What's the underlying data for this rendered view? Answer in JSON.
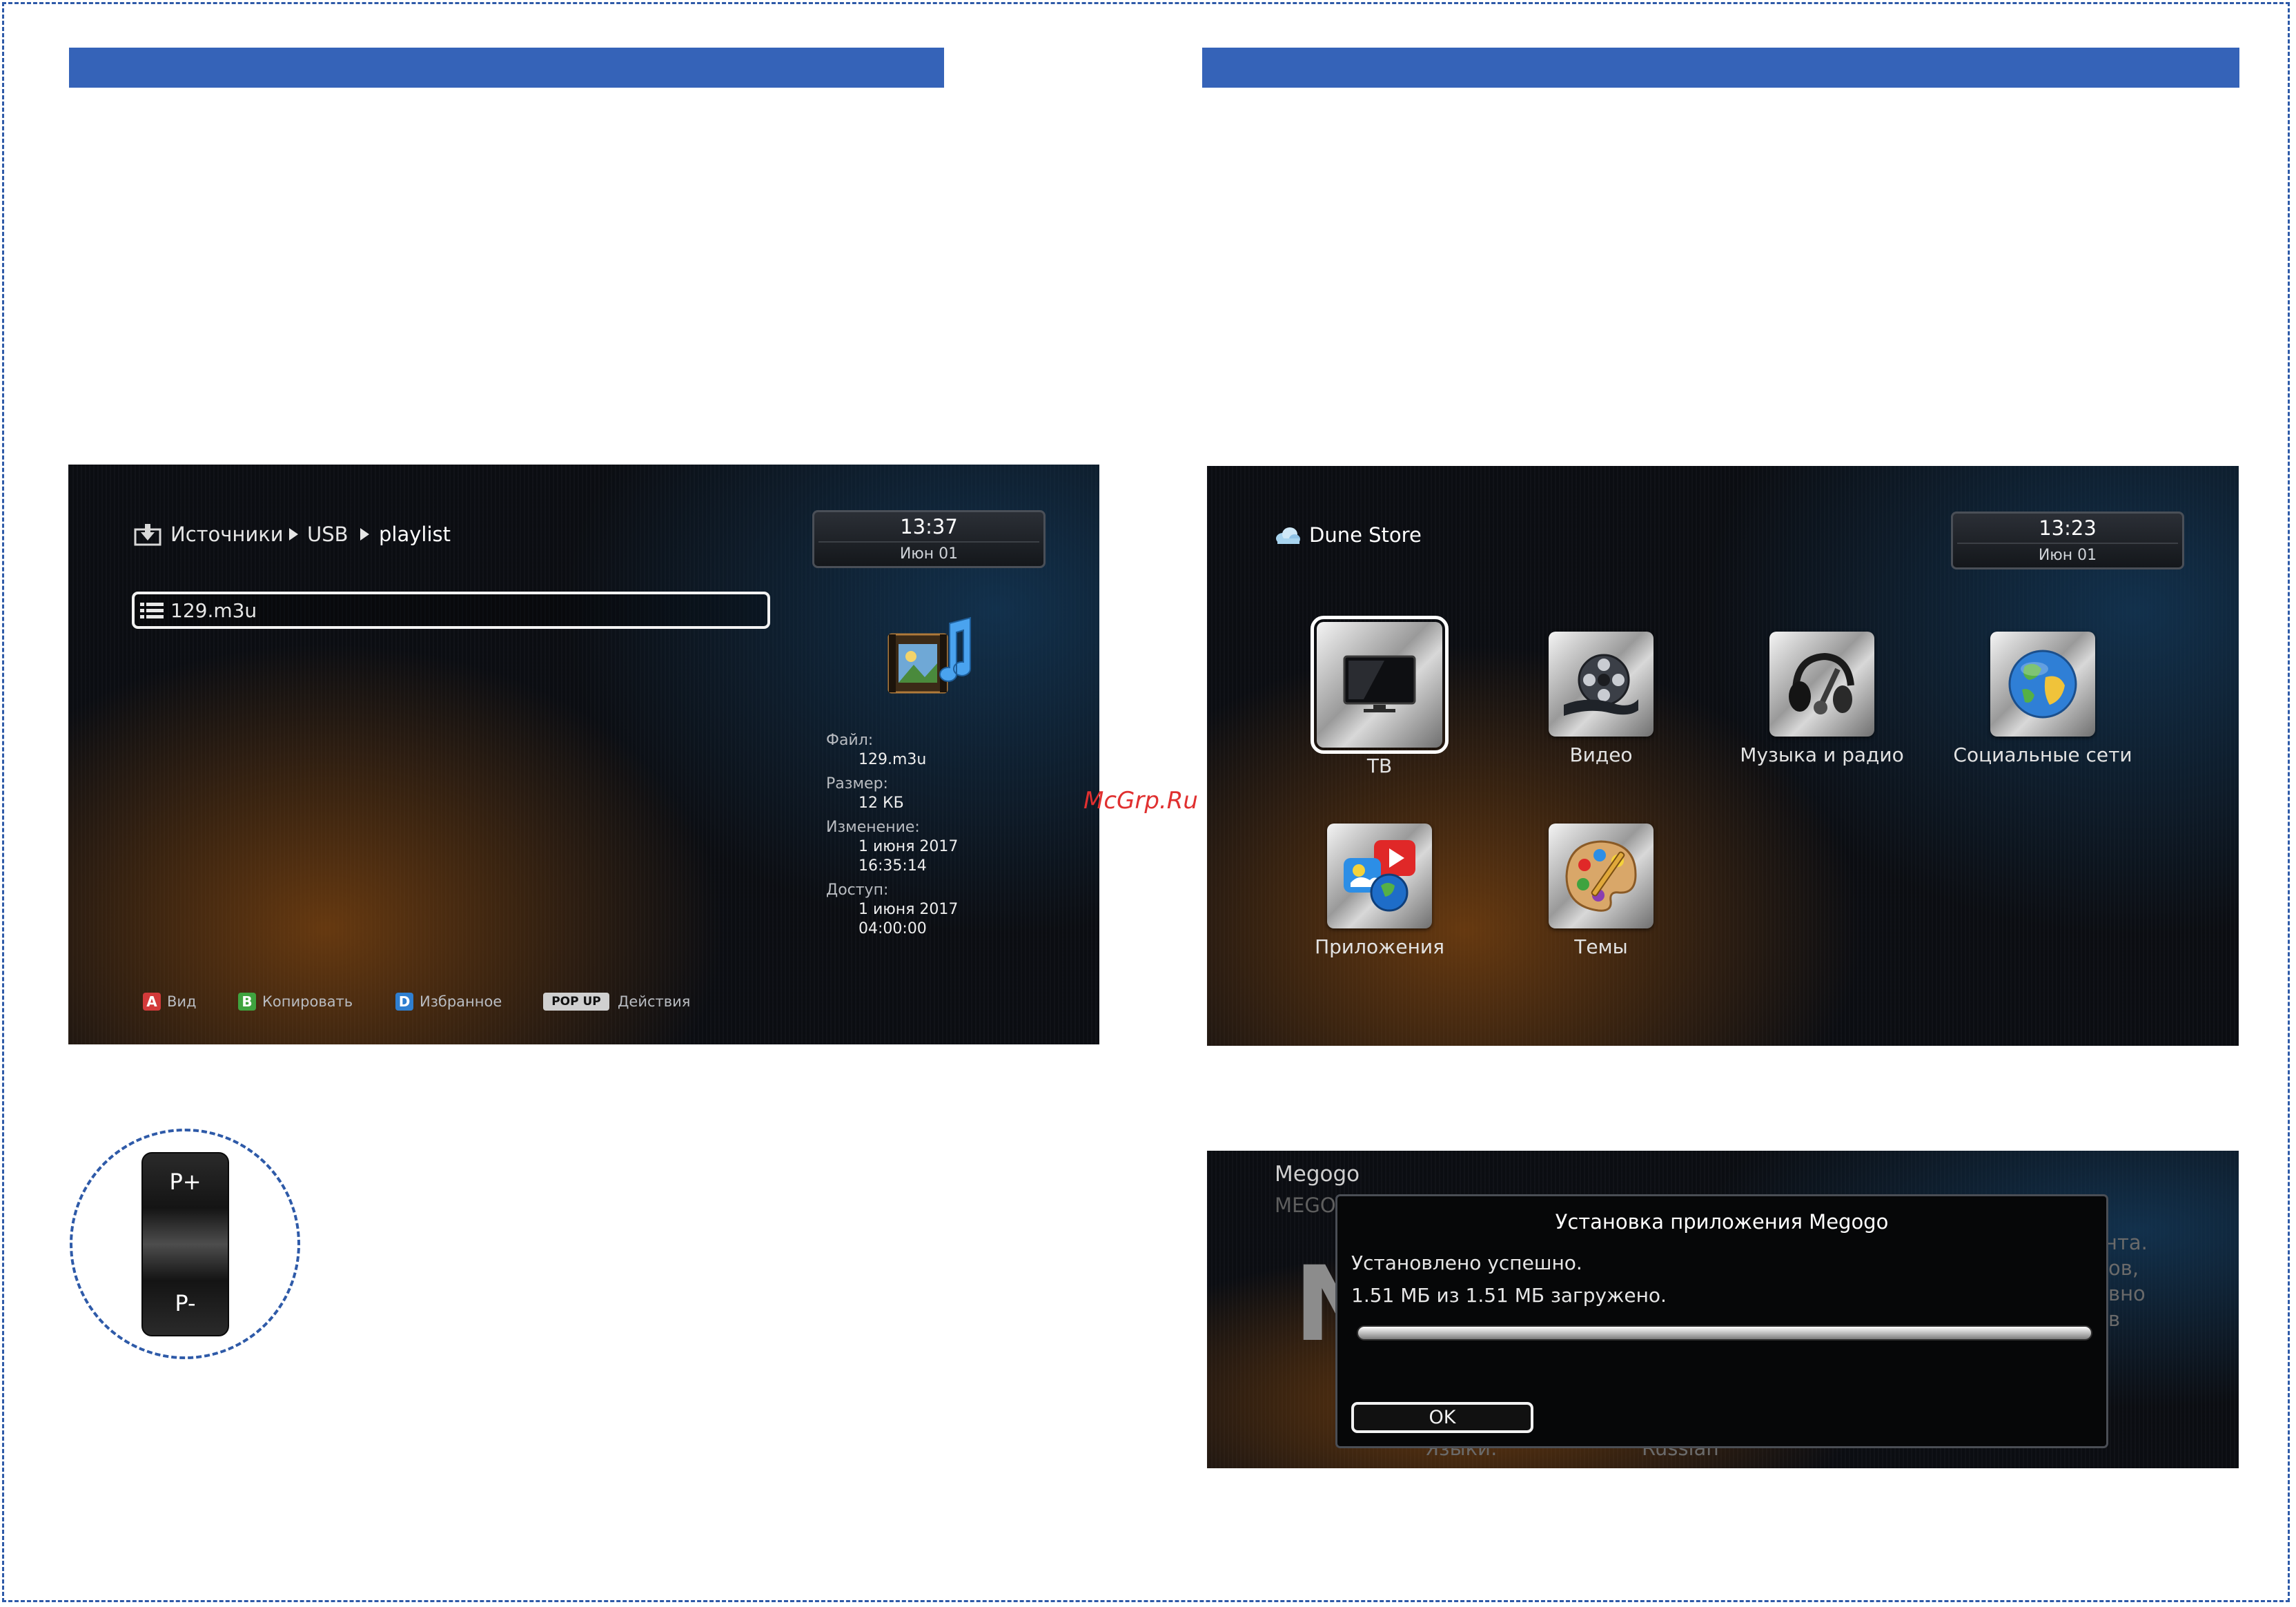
{
  "file_browser": {
    "breadcrumb": [
      "Источники",
      "USB",
      "playlist"
    ],
    "clock": {
      "time": "13:37",
      "date": "Июн 01"
    },
    "selected_file": "129.m3u",
    "info": {
      "file_label": "Файл:",
      "file_value": "129.m3u",
      "size_label": "Размер:",
      "size_value": "12 КБ",
      "modified_label": "Изменение:",
      "modified_date": "1 июня 2017",
      "modified_time": "16:35:14",
      "access_label": "Доступ:",
      "access_date": "1 июня 2017",
      "access_time": "04:00:00"
    },
    "footer": [
      {
        "key": "A",
        "label": "Вид",
        "color": "#d33a3a"
      },
      {
        "key": "B",
        "label": "Копировать",
        "color": "#3fa33f"
      },
      {
        "key": "D",
        "label": "Избранное",
        "color": "#2f7fd0"
      },
      {
        "key": "POP UP",
        "label": "Действия",
        "color": "#d0d0d0"
      }
    ]
  },
  "dune_store": {
    "title": "Dune Store",
    "clock": {
      "time": "13:23",
      "date": "Июн 01"
    },
    "tiles": [
      "ТВ",
      "Видео",
      "Музыка и радио",
      "Социальные сети",
      "Приложения",
      "Темы"
    ]
  },
  "install_dialog": {
    "app_name": "Megogo",
    "app_sub": "MEGO",
    "title": "Установка приложения Megogo",
    "status": "Установлено успешно.",
    "progress_text": "1.51 МБ из 1.51 МБ загружено.",
    "progress": 1.0,
    "ok_label": "OK",
    "bg_fragments": [
      "нта.",
      "ов,",
      "вно",
      "в",
      "Языки:",
      "Russian"
    ],
    "bg_letter": "N"
  },
  "remote": {
    "plus": "P+",
    "minus": "P-"
  },
  "watermark": "McGrp.Ru"
}
